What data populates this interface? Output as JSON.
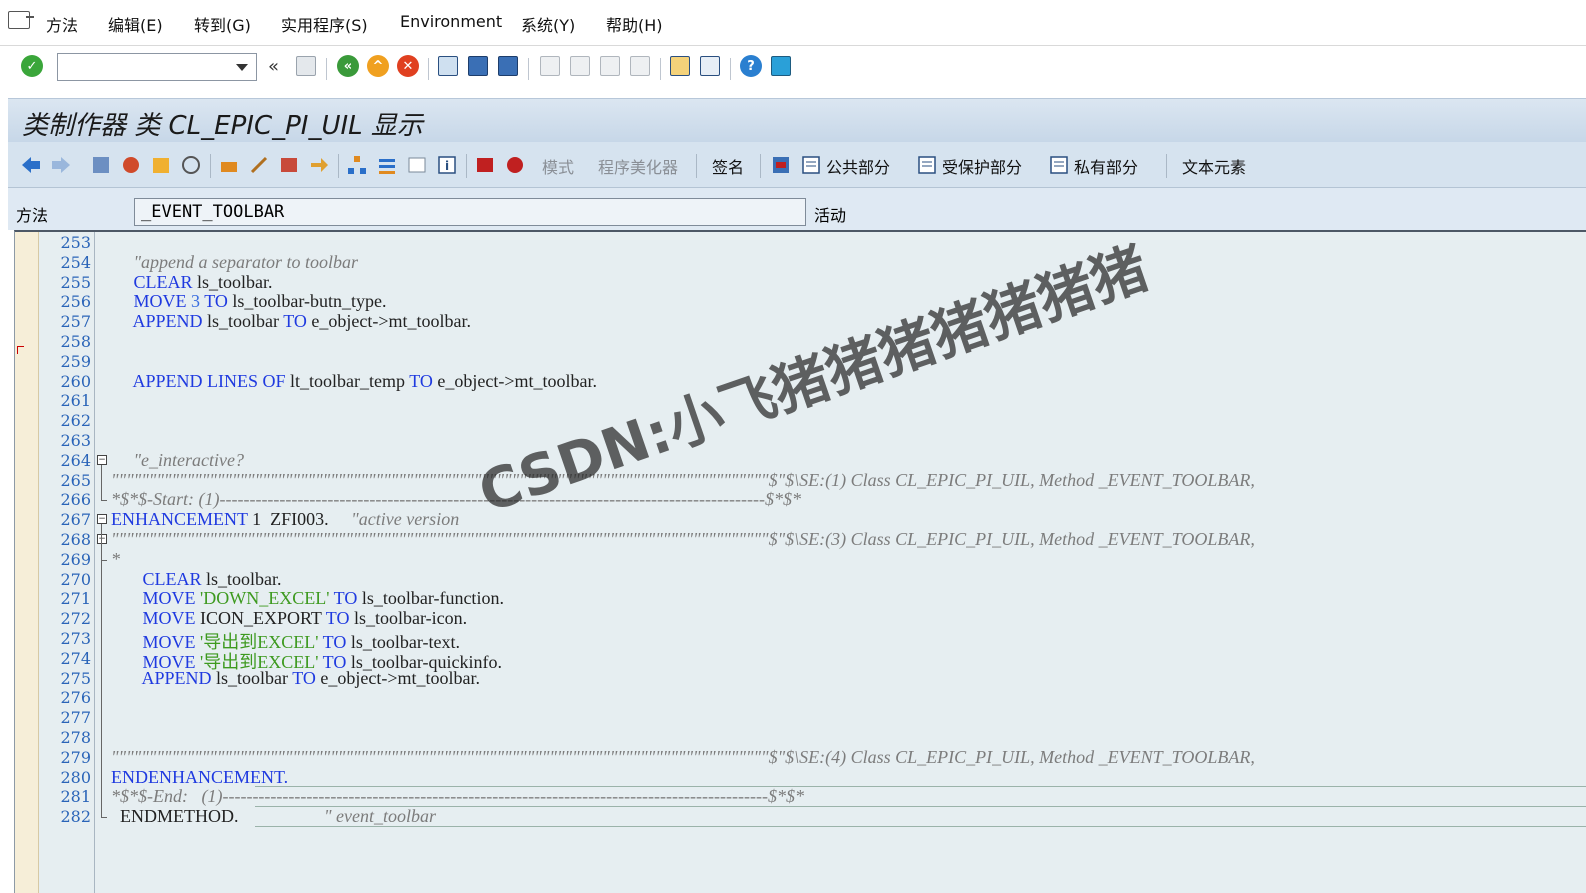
{
  "menu": {
    "items": [
      "方法",
      "编辑(E)",
      "转到(G)",
      "实用程序(S)",
      "Environment",
      "系统(Y)",
      "帮助(H)"
    ]
  },
  "toolbar": {
    "command_field_value": "",
    "icons": [
      "enter-icon",
      "save-icon",
      "back-icon",
      "exit-icon",
      "cancel-icon",
      "print-icon",
      "find-icon",
      "find-next-icon",
      "first-page-icon",
      "prev-page-icon",
      "next-page-icon",
      "last-page-icon",
      "new-session-icon",
      "shortcut-icon",
      "help-icon",
      "customize-layout-icon"
    ]
  },
  "title": "类制作器 类 CL_EPIC_PI_UIL 显示",
  "app_toolbar": {
    "mode_label": "模式",
    "pretty_printer_label": "程序美化器",
    "signature_label": "签名",
    "public_section_label": "公共部分",
    "protected_section_label": "受保护部分",
    "private_section_label": "私有部分",
    "text_elements_label": "文本元素"
  },
  "method_row": {
    "label": "方法",
    "value": "_EVENT_TOOLBAR",
    "status": "活动"
  },
  "editor": {
    "lines": [
      {
        "n": "253",
        "parts": []
      },
      {
        "n": "254",
        "parts": [
          {
            "t": "     \"append a separator to toolbar",
            "c": "cm"
          }
        ]
      },
      {
        "n": "255",
        "parts": [
          {
            "t": "     ",
            "c": ""
          },
          {
            "t": "CLEAR",
            "c": "kw"
          },
          {
            "t": " ls_toolbar.",
            "c": ""
          }
        ]
      },
      {
        "n": "256",
        "parts": [
          {
            "t": "     ",
            "c": ""
          },
          {
            "t": "MOVE",
            "c": "kw"
          },
          {
            "t": " ",
            "c": ""
          },
          {
            "t": "3",
            "c": "num"
          },
          {
            "t": " ",
            "c": ""
          },
          {
            "t": "TO",
            "c": "kw"
          },
          {
            "t": " ls_toolbar-butn_type.",
            "c": ""
          }
        ]
      },
      {
        "n": "257",
        "parts": [
          {
            "t": "     ",
            "c": ""
          },
          {
            "t": "APPEND",
            "c": "kw"
          },
          {
            "t": " ls_toolbar ",
            "c": ""
          },
          {
            "t": "TO",
            "c": "kw"
          },
          {
            "t": " e_object->mt_toolbar.",
            "c": ""
          }
        ]
      },
      {
        "n": "258",
        "parts": []
      },
      {
        "n": "259",
        "parts": []
      },
      {
        "n": "260",
        "parts": [
          {
            "t": "     ",
            "c": ""
          },
          {
            "t": "APPEND LINES OF",
            "c": "kw"
          },
          {
            "t": " lt_toolbar_temp ",
            "c": ""
          },
          {
            "t": "TO",
            "c": "kw"
          },
          {
            "t": " e_object->mt_toolbar.",
            "c": ""
          }
        ]
      },
      {
        "n": "261",
        "parts": []
      },
      {
        "n": "262",
        "parts": []
      },
      {
        "n": "263",
        "parts": []
      },
      {
        "n": "264",
        "parts": [
          {
            "t": "     \"e_interactive?",
            "c": "cm"
          }
        ]
      },
      {
        "n": "265",
        "parts": [
          {
            "t": "\"\"\"\"\"\"\"\"\"\"\"\"\"\"\"\"\"\"\"\"\"\"\"\"\"\"\"\"\"\"\"\"\"\"\"\"\"\"\"\"\"\"\"\"\"\"\"\"\"\"\"\"\"\"\"\"\"\"\"\"\"\"\"\"\"\"\"\"\"\"\"\"\"\"\"\"\"\"\"\"\"\"\"\"\"\"\"$\"$\\SE:(1) Class CL_EPIC_PI_UIL, Method _EVENT_TOOLBAR,",
            "c": "cm"
          }
        ]
      },
      {
        "n": "266",
        "parts": [
          {
            "t": "*$*$-Start: (1)-------------------------------------------------------------------------------------------$*$*",
            "c": "cm"
          }
        ]
      },
      {
        "n": "267",
        "parts": [
          {
            "t": "ENHANCEMENT",
            "c": "enh"
          },
          {
            "t": " 1  ZFI003.     ",
            "c": ""
          },
          {
            "t": "\"active version",
            "c": "cm"
          }
        ]
      },
      {
        "n": "268",
        "parts": [
          {
            "t": "\"\"\"\"\"\"\"\"\"\"\"\"\"\"\"\"\"\"\"\"\"\"\"\"\"\"\"\"\"\"\"\"\"\"\"\"\"\"\"\"\"\"\"\"\"\"\"\"\"\"\"\"\"\"\"\"\"\"\"\"\"\"\"\"\"\"\"\"\"\"\"\"\"\"\"\"\"\"\"\"\"\"\"\"\"\"\"$\"$\\SE:(3) Class CL_EPIC_PI_UIL, Method _EVENT_TOOLBAR,",
            "c": "cm"
          }
        ]
      },
      {
        "n": "269",
        "parts": [
          {
            "t": "*",
            "c": "cm"
          }
        ]
      },
      {
        "n": "270",
        "parts": [
          {
            "t": "       ",
            "c": ""
          },
          {
            "t": "CLEAR",
            "c": "kw"
          },
          {
            "t": " ls_toolbar.",
            "c": ""
          }
        ]
      },
      {
        "n": "271",
        "parts": [
          {
            "t": "       ",
            "c": ""
          },
          {
            "t": "MOVE",
            "c": "kw"
          },
          {
            "t": " ",
            "c": ""
          },
          {
            "t": "'DOWN_EXCEL'",
            "c": "str"
          },
          {
            "t": " ",
            "c": ""
          },
          {
            "t": "TO",
            "c": "kw"
          },
          {
            "t": " ls_toolbar-function.",
            "c": ""
          }
        ]
      },
      {
        "n": "272",
        "parts": [
          {
            "t": "       ",
            "c": ""
          },
          {
            "t": "MOVE",
            "c": "kw"
          },
          {
            "t": " ICON_EXPORT ",
            "c": ""
          },
          {
            "t": "TO",
            "c": "kw"
          },
          {
            "t": " ls_toolbar-icon.",
            "c": ""
          }
        ]
      },
      {
        "n": "273",
        "parts": [
          {
            "t": "       ",
            "c": ""
          },
          {
            "t": "MOVE",
            "c": "kw"
          },
          {
            "t": " ",
            "c": ""
          },
          {
            "t": "'导出到EXCEL'",
            "c": "str"
          },
          {
            "t": " ",
            "c": ""
          },
          {
            "t": "TO",
            "c": "kw"
          },
          {
            "t": " ls_toolbar-text.",
            "c": ""
          }
        ]
      },
      {
        "n": "274",
        "parts": [
          {
            "t": "       ",
            "c": ""
          },
          {
            "t": "MOVE",
            "c": "kw"
          },
          {
            "t": " ",
            "c": ""
          },
          {
            "t": "'导出到EXCEL'",
            "c": "str"
          },
          {
            "t": " ",
            "c": ""
          },
          {
            "t": "TO",
            "c": "kw"
          },
          {
            "t": " ls_toolbar-quickinfo.",
            "c": ""
          }
        ]
      },
      {
        "n": "275",
        "parts": [
          {
            "t": "       ",
            "c": ""
          },
          {
            "t": "APPEND",
            "c": "kw"
          },
          {
            "t": " ls_toolbar ",
            "c": ""
          },
          {
            "t": "TO",
            "c": "kw"
          },
          {
            "t": " e_object->mt_toolbar.",
            "c": ""
          }
        ]
      },
      {
        "n": "276",
        "parts": []
      },
      {
        "n": "277",
        "parts": []
      },
      {
        "n": "278",
        "parts": []
      },
      {
        "n": "279",
        "parts": [
          {
            "t": "\"\"\"\"\"\"\"\"\"\"\"\"\"\"\"\"\"\"\"\"\"\"\"\"\"\"\"\"\"\"\"\"\"\"\"\"\"\"\"\"\"\"\"\"\"\"\"\"\"\"\"\"\"\"\"\"\"\"\"\"\"\"\"\"\"\"\"\"\"\"\"\"\"\"\"\"\"\"\"\"\"\"\"\"\"\"\"$\"$\\SE:(4) Class CL_EPIC_PI_UIL, Method _EVENT_TOOLBAR,",
            "c": "cm"
          }
        ]
      },
      {
        "n": "280",
        "parts": [
          {
            "t": "ENDENHANCEMENT.",
            "c": "enh"
          }
        ]
      },
      {
        "n": "281",
        "parts": [
          {
            "t": "*$*$-End:   (1)-------------------------------------------------------------------------------------------$*$*",
            "c": "cm"
          }
        ]
      },
      {
        "n": "282",
        "parts": [
          {
            "t": "  ENDMETHOD.",
            "c": ""
          },
          {
            "t": "                   \" event_toolbar",
            "c": "cm"
          }
        ]
      }
    ]
  },
  "watermark": "CSDN:小飞猪猪猪猪猪猪猪"
}
